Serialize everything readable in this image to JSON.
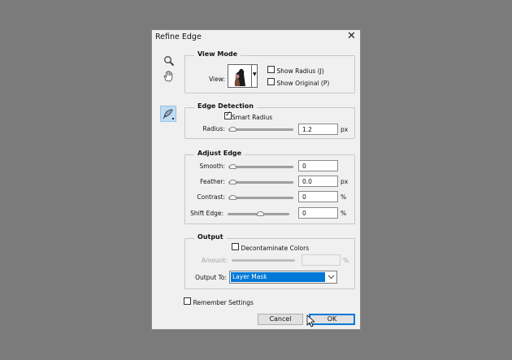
{
  "title": "Refine Edge",
  "tools": {
    "zoom": "zoom-tool",
    "hand": "hand-tool",
    "refine_radius": "refine-radius-tool"
  },
  "view_mode": {
    "label": "View Mode",
    "view_label": "View:",
    "show_radius": "Show Radius (J)",
    "show_original": "Show Original (P)",
    "show_radius_checked": false,
    "show_original_checked": false
  },
  "edge_detection": {
    "label": "Edge Detection",
    "smart_radius": "Smart Radius",
    "smart_radius_checked": true,
    "radius_label": "Radius:",
    "radius_value": "1.2",
    "radius_unit": "px"
  },
  "adjust_edge": {
    "label": "Adjust Edge",
    "rows": [
      {
        "label": "Smooth:",
        "value": "0",
        "unit": ""
      },
      {
        "label": "Feather:",
        "value": "0.0",
        "unit": "px"
      },
      {
        "label": "Contrast:",
        "value": "0",
        "unit": "%"
      },
      {
        "label": "Shift Edge:",
        "value": "0",
        "unit": "%"
      }
    ]
  },
  "output": {
    "label": "Output",
    "decontaminate": "Decontaminate Colors",
    "decontaminate_checked": false,
    "amount_label": "Amount:",
    "amount_unit": "%",
    "output_to_label": "Output To:",
    "output_to_value": "Layer Mask"
  },
  "remember": "Remember Settings",
  "buttons": {
    "cancel": "Cancel",
    "ok": "OK"
  },
  "colors": {
    "selection": "#0078d7",
    "ok_border": "#0078d7"
  }
}
